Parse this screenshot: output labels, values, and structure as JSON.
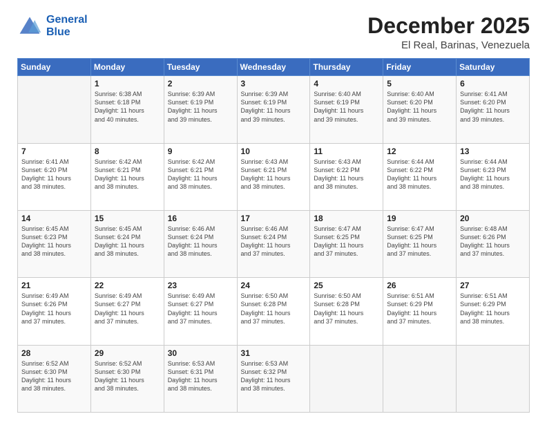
{
  "header": {
    "logo": {
      "line1": "General",
      "line2": "Blue"
    },
    "title": "December 2025",
    "location": "El Real, Barinas, Venezuela"
  },
  "calendar": {
    "days_of_week": [
      "Sunday",
      "Monday",
      "Tuesday",
      "Wednesday",
      "Thursday",
      "Friday",
      "Saturday"
    ],
    "weeks": [
      [
        {
          "day": "",
          "info": ""
        },
        {
          "day": "1",
          "info": "Sunrise: 6:38 AM\nSunset: 6:18 PM\nDaylight: 11 hours\nand 40 minutes."
        },
        {
          "day": "2",
          "info": "Sunrise: 6:39 AM\nSunset: 6:19 PM\nDaylight: 11 hours\nand 39 minutes."
        },
        {
          "day": "3",
          "info": "Sunrise: 6:39 AM\nSunset: 6:19 PM\nDaylight: 11 hours\nand 39 minutes."
        },
        {
          "day": "4",
          "info": "Sunrise: 6:40 AM\nSunset: 6:19 PM\nDaylight: 11 hours\nand 39 minutes."
        },
        {
          "day": "5",
          "info": "Sunrise: 6:40 AM\nSunset: 6:20 PM\nDaylight: 11 hours\nand 39 minutes."
        },
        {
          "day": "6",
          "info": "Sunrise: 6:41 AM\nSunset: 6:20 PM\nDaylight: 11 hours\nand 39 minutes."
        }
      ],
      [
        {
          "day": "7",
          "info": "Sunrise: 6:41 AM\nSunset: 6:20 PM\nDaylight: 11 hours\nand 38 minutes."
        },
        {
          "day": "8",
          "info": "Sunrise: 6:42 AM\nSunset: 6:21 PM\nDaylight: 11 hours\nand 38 minutes."
        },
        {
          "day": "9",
          "info": "Sunrise: 6:42 AM\nSunset: 6:21 PM\nDaylight: 11 hours\nand 38 minutes."
        },
        {
          "day": "10",
          "info": "Sunrise: 6:43 AM\nSunset: 6:21 PM\nDaylight: 11 hours\nand 38 minutes."
        },
        {
          "day": "11",
          "info": "Sunrise: 6:43 AM\nSunset: 6:22 PM\nDaylight: 11 hours\nand 38 minutes."
        },
        {
          "day": "12",
          "info": "Sunrise: 6:44 AM\nSunset: 6:22 PM\nDaylight: 11 hours\nand 38 minutes."
        },
        {
          "day": "13",
          "info": "Sunrise: 6:44 AM\nSunset: 6:23 PM\nDaylight: 11 hours\nand 38 minutes."
        }
      ],
      [
        {
          "day": "14",
          "info": "Sunrise: 6:45 AM\nSunset: 6:23 PM\nDaylight: 11 hours\nand 38 minutes."
        },
        {
          "day": "15",
          "info": "Sunrise: 6:45 AM\nSunset: 6:24 PM\nDaylight: 11 hours\nand 38 minutes."
        },
        {
          "day": "16",
          "info": "Sunrise: 6:46 AM\nSunset: 6:24 PM\nDaylight: 11 hours\nand 38 minutes."
        },
        {
          "day": "17",
          "info": "Sunrise: 6:46 AM\nSunset: 6:24 PM\nDaylight: 11 hours\nand 37 minutes."
        },
        {
          "day": "18",
          "info": "Sunrise: 6:47 AM\nSunset: 6:25 PM\nDaylight: 11 hours\nand 37 minutes."
        },
        {
          "day": "19",
          "info": "Sunrise: 6:47 AM\nSunset: 6:25 PM\nDaylight: 11 hours\nand 37 minutes."
        },
        {
          "day": "20",
          "info": "Sunrise: 6:48 AM\nSunset: 6:26 PM\nDaylight: 11 hours\nand 37 minutes."
        }
      ],
      [
        {
          "day": "21",
          "info": "Sunrise: 6:49 AM\nSunset: 6:26 PM\nDaylight: 11 hours\nand 37 minutes."
        },
        {
          "day": "22",
          "info": "Sunrise: 6:49 AM\nSunset: 6:27 PM\nDaylight: 11 hours\nand 37 minutes."
        },
        {
          "day": "23",
          "info": "Sunrise: 6:49 AM\nSunset: 6:27 PM\nDaylight: 11 hours\nand 37 minutes."
        },
        {
          "day": "24",
          "info": "Sunrise: 6:50 AM\nSunset: 6:28 PM\nDaylight: 11 hours\nand 37 minutes."
        },
        {
          "day": "25",
          "info": "Sunrise: 6:50 AM\nSunset: 6:28 PM\nDaylight: 11 hours\nand 37 minutes."
        },
        {
          "day": "26",
          "info": "Sunrise: 6:51 AM\nSunset: 6:29 PM\nDaylight: 11 hours\nand 37 minutes."
        },
        {
          "day": "27",
          "info": "Sunrise: 6:51 AM\nSunset: 6:29 PM\nDaylight: 11 hours\nand 38 minutes."
        }
      ],
      [
        {
          "day": "28",
          "info": "Sunrise: 6:52 AM\nSunset: 6:30 PM\nDaylight: 11 hours\nand 38 minutes."
        },
        {
          "day": "29",
          "info": "Sunrise: 6:52 AM\nSunset: 6:30 PM\nDaylight: 11 hours\nand 38 minutes."
        },
        {
          "day": "30",
          "info": "Sunrise: 6:53 AM\nSunset: 6:31 PM\nDaylight: 11 hours\nand 38 minutes."
        },
        {
          "day": "31",
          "info": "Sunrise: 6:53 AM\nSunset: 6:32 PM\nDaylight: 11 hours\nand 38 minutes."
        },
        {
          "day": "",
          "info": ""
        },
        {
          "day": "",
          "info": ""
        },
        {
          "day": "",
          "info": ""
        }
      ]
    ]
  }
}
